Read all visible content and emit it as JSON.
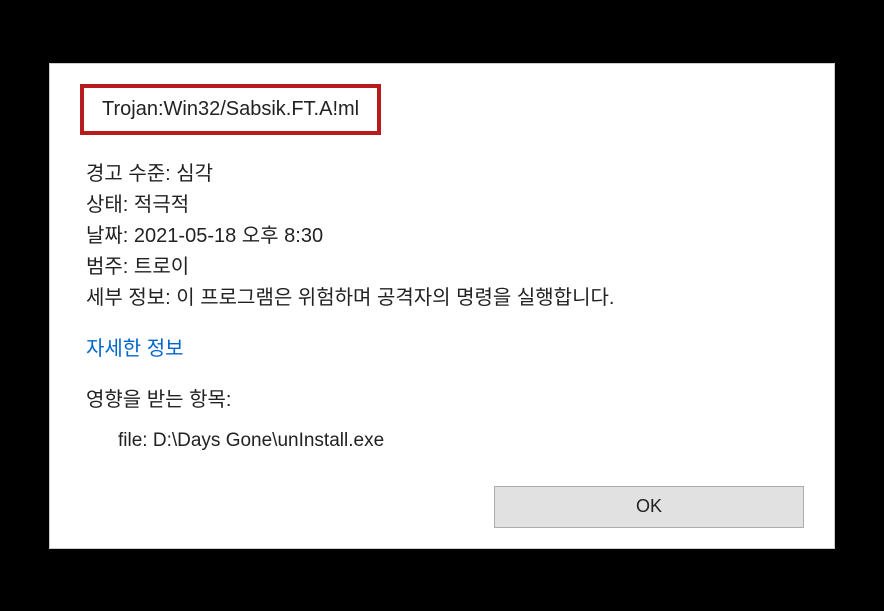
{
  "threat": {
    "name": "Trojan:Win32/Sabsik.FT.A!ml"
  },
  "info": {
    "alert_level_label": "경고 수준:",
    "alert_level_value": "심각",
    "status_label": "상태:",
    "status_value": "적극적",
    "date_label": "날짜:",
    "date_value": "2021-05-18 오후 8:30",
    "category_label": "범주:",
    "category_value": "트로이",
    "details_label": "세부 정보:",
    "details_value": "이 프로그램은 위험하며 공격자의 명령을 실행합니다."
  },
  "links": {
    "more_info": "자세한 정보"
  },
  "affected": {
    "title": "영향을 받는 항목:",
    "file": "file: D:\\Days Gone\\unInstall.exe"
  },
  "buttons": {
    "ok": "OK"
  }
}
